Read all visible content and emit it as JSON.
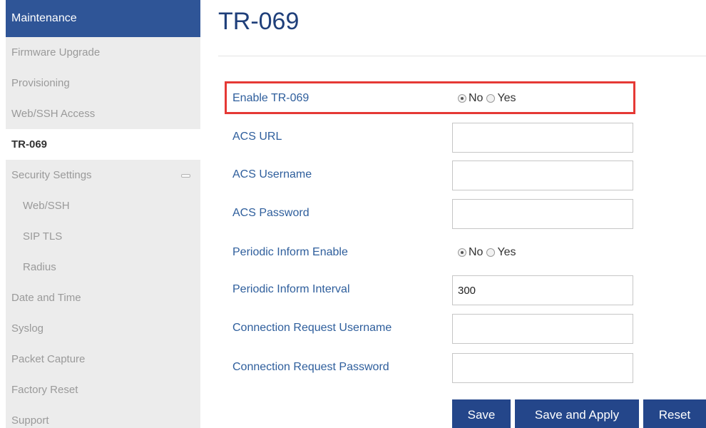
{
  "sidebar": {
    "header": "Maintenance",
    "items": [
      {
        "label": "Firmware Upgrade"
      },
      {
        "label": "Provisioning"
      },
      {
        "label": "Web/SSH Access"
      },
      {
        "label": "TR-069"
      },
      {
        "label": "Security Settings"
      },
      {
        "label": "Web/SSH"
      },
      {
        "label": "SIP TLS"
      },
      {
        "label": "Radius"
      },
      {
        "label": "Date and Time"
      },
      {
        "label": "Syslog"
      },
      {
        "label": "Packet Capture"
      },
      {
        "label": "Factory Reset"
      },
      {
        "label": "Support"
      }
    ]
  },
  "page": {
    "title": "TR-069"
  },
  "form": {
    "enable": {
      "label": "Enable TR-069",
      "no": "No",
      "yes": "Yes",
      "selected": "No"
    },
    "acs_url": {
      "label": "ACS URL",
      "value": ""
    },
    "acs_username": {
      "label": "ACS Username",
      "value": ""
    },
    "acs_password": {
      "label": "ACS Password",
      "value": ""
    },
    "periodic_enable": {
      "label": "Periodic Inform Enable",
      "no": "No",
      "yes": "Yes",
      "selected": "No"
    },
    "periodic_interval": {
      "label": "Periodic Inform Interval",
      "value": "300"
    },
    "conn_username": {
      "label": "Connection Request Username",
      "value": ""
    },
    "conn_password": {
      "label": "Connection Request Password",
      "value": ""
    }
  },
  "buttons": {
    "save": "Save",
    "save_apply": "Save and Apply",
    "reset": "Reset"
  },
  "colors": {
    "sidebar_header": "#2f5597",
    "accent": "#24468a",
    "label": "#2e5e9c",
    "highlight": "#e53935"
  }
}
